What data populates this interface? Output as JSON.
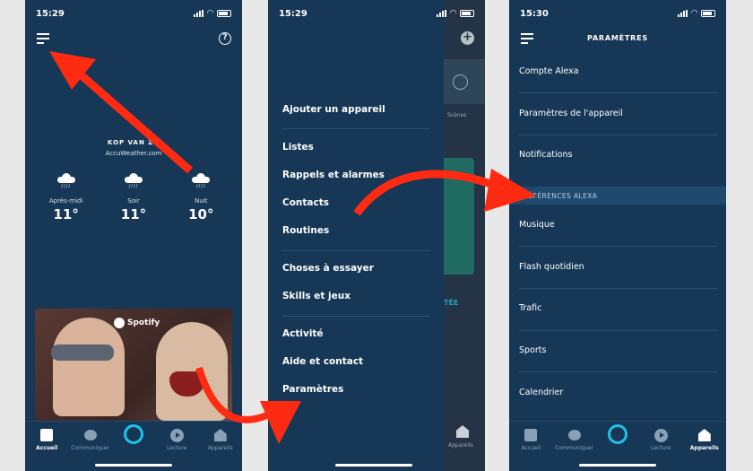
{
  "screens": {
    "home": {
      "status": {
        "time": "15:29"
      },
      "weather": {
        "location": "KOP VAN ZU",
        "source": "AccuWeather.com",
        "forecast": [
          {
            "label": "Après-midi",
            "temp": "11°",
            "icon": "rain-cloud-icon"
          },
          {
            "label": "Soir",
            "temp": "11°",
            "icon": "rain-cloud-icon"
          },
          {
            "label": "Nuit",
            "temp": "10°",
            "icon": "rain-cloud-icon"
          }
        ]
      },
      "card": {
        "brand": "Spotify"
      },
      "tabbar": [
        {
          "label": "Accueil",
          "icon": "home-icon",
          "active": true
        },
        {
          "label": "Communiquer",
          "icon": "chat-icon",
          "active": false
        },
        {
          "label": "",
          "icon": "alexa-icon",
          "active": false
        },
        {
          "label": "Lecture",
          "icon": "play-icon",
          "active": false
        },
        {
          "label": "Appareils",
          "icon": "devices-icon",
          "active": false
        }
      ]
    },
    "drawer": {
      "status": {
        "time": "15:29"
      },
      "items": [
        "Ajouter un appareil",
        "Listes",
        "Rappels et alarmes",
        "Contacts",
        "Routines",
        "Choses à essayer",
        "Skills et jeux",
        "Activité",
        "Aide et contact",
        "Paramètres"
      ],
      "behind": {
        "scenes_label": "Scènes",
        "partial_label": "TÉE",
        "devices_label": "Appareils"
      }
    },
    "settings": {
      "status": {
        "time": "15:30"
      },
      "title": "PARAMÈTRES",
      "items_top": [
        "Compte Alexa",
        "Paramètres de l'appareil",
        "Notifications"
      ],
      "section_header": "PRÉFÉRENCES ALEXA",
      "items_prefs": [
        "Musique",
        "Flash quotidien",
        "Trafic",
        "Sports",
        "Calendrier"
      ],
      "tabbar": [
        {
          "label": "Accueil",
          "icon": "home-icon",
          "active": false
        },
        {
          "label": "Communiquer",
          "icon": "chat-icon",
          "active": false
        },
        {
          "label": "",
          "icon": "alexa-icon",
          "active": false
        },
        {
          "label": "Lecture",
          "icon": "play-icon",
          "active": false
        },
        {
          "label": "Appareils",
          "icon": "devices-icon",
          "active": true
        }
      ]
    }
  },
  "colors": {
    "background": "#163756",
    "accent": "#1ec3ea",
    "annotation_arrow": "#ff2a12"
  }
}
